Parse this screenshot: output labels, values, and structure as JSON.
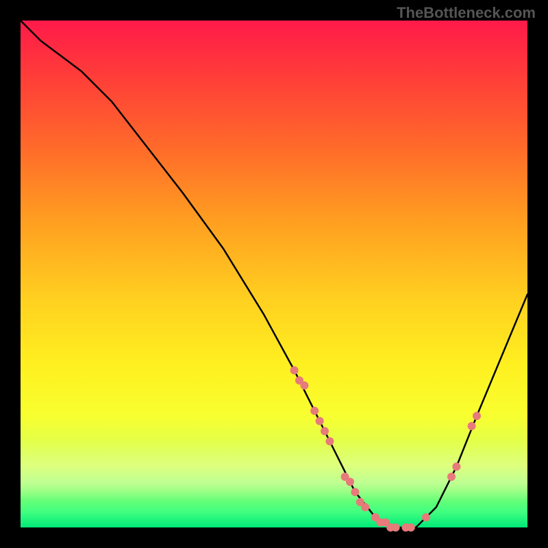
{
  "watermark": "TheBottleneck.com",
  "chart_data": {
    "type": "line",
    "title": "",
    "xlabel": "",
    "ylabel": "",
    "xlim": [
      0,
      100
    ],
    "ylim": [
      0,
      100
    ],
    "grid": false,
    "series": [
      {
        "name": "curve",
        "color": "#000000",
        "x": [
          0,
          4,
          8,
          12,
          18,
          25,
          32,
          40,
          48,
          54,
          58,
          62,
          66,
          70,
          74,
          78,
          82,
          86,
          90,
          95,
          100
        ],
        "y": [
          100,
          96,
          93,
          90,
          84,
          75,
          66,
          55,
          42,
          31,
          23,
          15,
          7,
          2,
          0,
          0,
          4,
          12,
          22,
          34,
          46
        ]
      }
    ],
    "markers": {
      "name": "highlight-points",
      "color": "#e77a7a",
      "x": [
        54,
        55,
        56,
        58,
        59,
        60,
        61,
        64,
        65,
        66,
        67,
        68,
        70,
        71,
        72,
        73,
        74,
        76,
        77,
        80,
        85,
        86,
        89,
        90
      ],
      "y": [
        31,
        29,
        28,
        23,
        21,
        19,
        17,
        10,
        9,
        7,
        5,
        4,
        2,
        1,
        1,
        0,
        0,
        0,
        0,
        2,
        10,
        12,
        20,
        22
      ]
    }
  }
}
